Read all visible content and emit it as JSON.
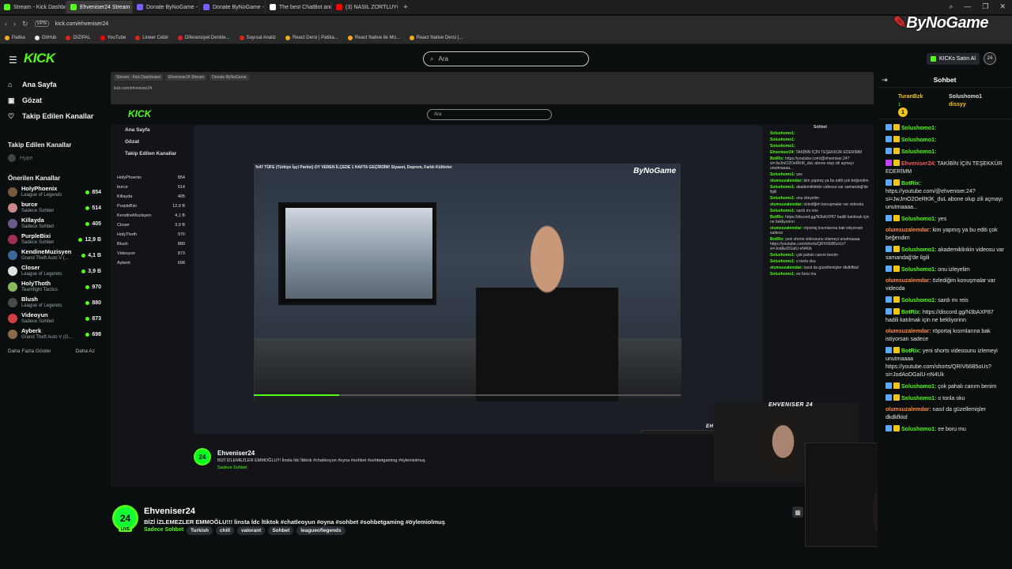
{
  "browser": {
    "tabs": [
      {
        "label": "Stream - Kick Dashboard",
        "color": "#53fc18",
        "active": false
      },
      {
        "label": "Ehveniser24 Stream - Ki",
        "color": "#53fc18",
        "active": true
      },
      {
        "label": "Donate ByNoGame - Geli",
        "color": "#7b5cff",
        "active": false
      },
      {
        "label": "Donate ByNoGame - BNG",
        "color": "#7b5cff",
        "active": false
      },
      {
        "label": "The best ChatBot and Wi",
        "color": "#ffffff",
        "active": false
      },
      {
        "label": "(3) NASIL ZORTLUYORUM",
        "color": "#ff0000",
        "active": false
      }
    ],
    "new_tab": "+",
    "url": "kick.com/ehveniser24",
    "vpn": "VPN",
    "bookmarks": [
      {
        "label": "Patika",
        "color": "#f5a623"
      },
      {
        "label": "GitHub",
        "color": "#eeeeee"
      },
      {
        "label": "DIZIPAL",
        "color": "#e02020"
      },
      {
        "label": "YouTube",
        "color": "#ff0000"
      },
      {
        "label": "Lineer Cebir",
        "color": "#e02020"
      },
      {
        "label": "Diferansiyel Denkle...",
        "color": "#e02020"
      },
      {
        "label": "Sayısal Analiz",
        "color": "#e02020"
      },
      {
        "label": "React Dersi | Patika...",
        "color": "#f5a623"
      },
      {
        "label": "React Native ile Mo...",
        "color": "#f5a623"
      },
      {
        "label": "React Native Dersi |...",
        "color": "#f5a623"
      }
    ],
    "overlay_logo": "ByNoGame"
  },
  "header": {
    "logo": "KICK",
    "search_placeholder": "Ara",
    "buy_kicks": "KICKs Satın Al",
    "avatar": "24"
  },
  "sidebar": {
    "nav": [
      {
        "label": "Ana Sayfa",
        "icon": "home-icon"
      },
      {
        "label": "Gözat",
        "icon": "browse-icon"
      },
      {
        "label": "Takip Edilen Kanallar",
        "icon": "heart-icon"
      }
    ],
    "followed_title": "Takip Edilen Kanallar",
    "hype": "Hype",
    "recommended_title": "Önerilen Kanallar",
    "channels": [
      {
        "name": "HolyPhoenix",
        "game": "League of Legends",
        "viewers": "854",
        "color": "#7a5a3a"
      },
      {
        "name": "burce",
        "game": "Sadece Sohbet",
        "viewers": "514",
        "color": "#c98a8a"
      },
      {
        "name": "Killayda",
        "game": "Sadece Sohbet",
        "viewers": "405",
        "color": "#6a5a8a"
      },
      {
        "name": "PurpleBixi",
        "game": "Sadece Sohbet",
        "viewers": "12,9 B",
        "color": "#a03050"
      },
      {
        "name": "KendineMuzisyen",
        "game": "Grand Theft Auto V (...",
        "viewers": "4,1 B",
        "color": "#3a6a9a"
      },
      {
        "name": "Closer",
        "game": "League of Legends",
        "viewers": "3,9 B",
        "color": "#e0e0e0"
      },
      {
        "name": "HolyThoth",
        "game": "Teamfight Tactics",
        "viewers": "970",
        "color": "#8aba5a"
      },
      {
        "name": "Blush",
        "game": "League of Legends",
        "viewers": "880",
        "color": "#4a4a4a"
      },
      {
        "name": "Videoyun",
        "game": "Sadece Sohbet",
        "viewers": "873",
        "color": "#d04040"
      },
      {
        "name": "Ayberk",
        "game": "Grand Theft Auto V (G...",
        "viewers": "698",
        "color": "#8a6a4a"
      }
    ],
    "show_more": "Daha Fazla Göster",
    "show_less": "Daha Az"
  },
  "stream": {
    "video_title": "%47 TÜFE (Türkiye İşçi Partisi) OY VEREN İLÇEDE 1 HAFTA GEÇİRDİM! Siyaset, Deprem, Farklı Kültürler",
    "webcam_label": "EHVENISER 24",
    "progress": 0.2
  },
  "channel": {
    "name": "Ehveniser24",
    "avatar": "24",
    "live": "LIVE",
    "description": "BİZİ İZLEMEZLER EMMOĞLU!!! İinsta İdc İtiktok #chatleoyun #oyna #sohbet #sohbetgaming #öylemiolmuş",
    "category": "Sadece Sohbet",
    "tags": [
      "Turkish",
      "chill",
      "valorant",
      "Sohbet",
      "leagueoflegends"
    ]
  },
  "chat": {
    "title": "Sohbet",
    "pinned": {
      "user1": "TuranBzk",
      "user1_count": "1",
      "user2": "Solushomo1",
      "user2_count": "1",
      "user3": "dissyy"
    },
    "messages": [
      {
        "user": "Solushomo1:",
        "text": "",
        "color": "u-green",
        "badge": "#5da9ff"
      },
      {
        "user": "Solushomo1:",
        "text": "",
        "color": "u-green",
        "badge": "#5da9ff"
      },
      {
        "user": "Solushomo1:",
        "text": "",
        "color": "u-green",
        "badge": "#5da9ff"
      },
      {
        "user": "Ehveniser24:",
        "text": "TAKİBİN İÇİN TEŞEKKÜR EDERİMM",
        "color": "u-red",
        "badge": "#c040ff"
      },
      {
        "user": "BotRix:",
        "text": "https://youtube.com/@ehveniser.24?si=JwJmO2OeRKlK_duL abone olup zili açmayı unutmaaaa...",
        "color": "u-green",
        "badge": "#5da9ff"
      },
      {
        "user": "Solushomo1:",
        "text": "yes",
        "color": "u-green",
        "badge": "#5da9ff"
      },
      {
        "user": "olumsuzalemdar:",
        "text": "kim yapmış ya bu editi çok beğendim",
        "color": "u-orange",
        "badge": ""
      },
      {
        "user": "Solushomo1:",
        "text": "akademiklinkin videosu var samandağ'de ilgili",
        "color": "u-green",
        "badge": "#5da9ff"
      },
      {
        "user": "Solushomo1:",
        "text": "onu izleyelim",
        "color": "u-green",
        "badge": "#5da9ff"
      },
      {
        "user": "olumsuzalemdar:",
        "text": "özlediğim konuşmalar var videoda",
        "color": "u-orange",
        "badge": ""
      },
      {
        "user": "Solushomo1:",
        "text": "sardı mı reis",
        "color": "u-green",
        "badge": "#5da9ff"
      },
      {
        "user": "BotRix:",
        "text": "https://discord.gg/N3bAXP87 hadili katılmak için ne bekliyorinn",
        "color": "u-green",
        "badge": "#5da9ff"
      },
      {
        "user": "olumsuzalemdar:",
        "text": "röportaj kısımlarına bak istiyorsan sadece",
        "color": "u-orange",
        "badge": ""
      },
      {
        "user": "BotRix:",
        "text": "yeni shorts videosunu izlemeyi unutmaaaa https://youtube.com/shorts/QRIV66B5oUs?si=JodAoDGaIU-nN4Uk",
        "color": "u-green",
        "badge": "#5da9ff"
      },
      {
        "user": "Solushomo1:",
        "text": "çok pahalı canım benim",
        "color": "u-green",
        "badge": "#5da9ff"
      },
      {
        "user": "Solushomo1:",
        "text": "o tonla oku",
        "color": "u-green",
        "badge": "#5da9ff"
      },
      {
        "user": "olumsuzalemdar:",
        "text": "nasıl da güzellemişler dkdkfkkd",
        "color": "u-orange",
        "badge": ""
      },
      {
        "user": "Solushomo1:",
        "text": "ee boru mu",
        "color": "u-green",
        "badge": "#5da9ff"
      }
    ]
  }
}
